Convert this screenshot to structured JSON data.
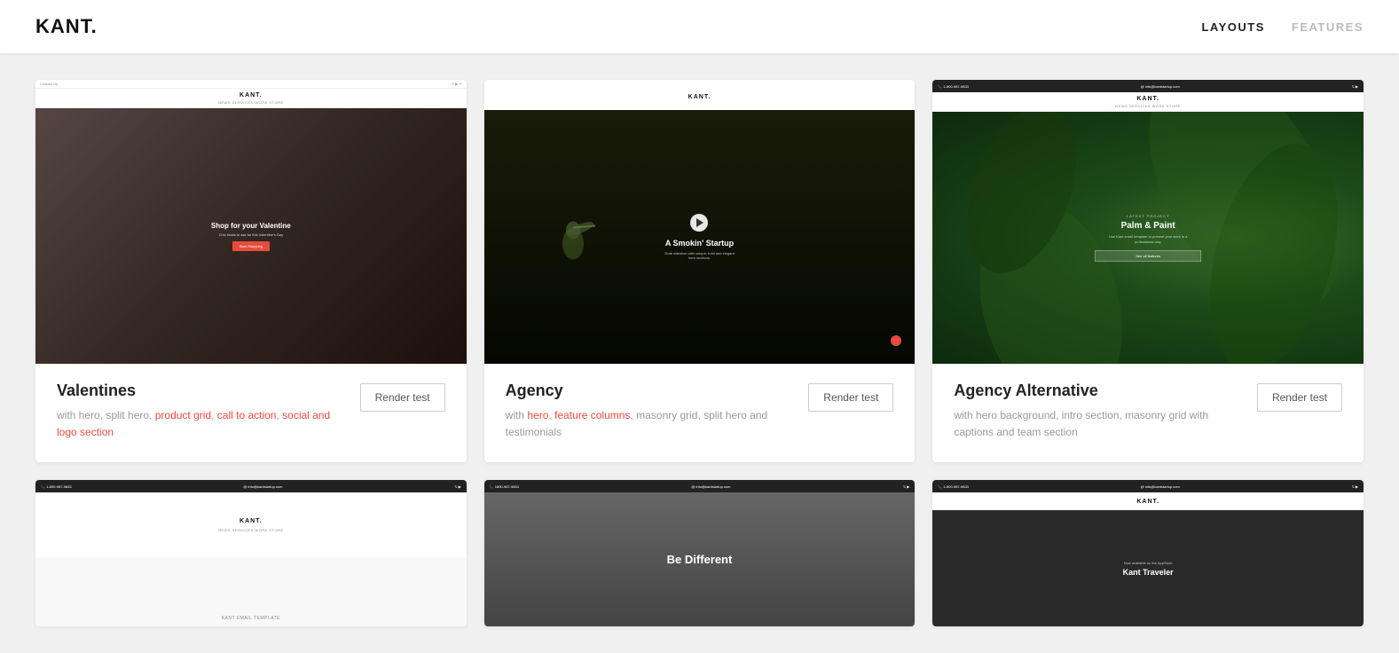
{
  "header": {
    "logo": "KANT.",
    "nav": [
      {
        "label": "LAYOUTS",
        "active": true
      },
      {
        "label": "FEATURES",
        "active": false
      }
    ]
  },
  "cards": [
    {
      "id": "valentines",
      "title": "Valentines",
      "description_parts": [
        {
          "text": "with hero, split hero, "
        },
        {
          "text": "product grid",
          "link": true
        },
        {
          "text": ", "
        },
        {
          "text": "call to action",
          "link": true
        },
        {
          "text": ", "
        },
        {
          "text": "social and logo section",
          "link": true
        }
      ],
      "render_btn": "Render test",
      "preview": {
        "topbar_text": "Contact Us",
        "topbar_icons": "✦ ▶ ✦",
        "logo": "KANT.",
        "nav_items": "NEWS    SERVICES    WORK    STORE",
        "hero_title": "Shop for your Valentine",
        "hero_subtitle": "Chic treats to ask for this Valentine's Day",
        "hero_btn": "Start Shopping"
      }
    },
    {
      "id": "agency",
      "title": "Agency",
      "description_parts": [
        {
          "text": "with "
        },
        {
          "text": "hero",
          "link": true
        },
        {
          "text": ", "
        },
        {
          "text": "feature columns",
          "link": true
        },
        {
          "text": ", masonry grid, split hero and testimonials"
        }
      ],
      "render_btn": "Render test",
      "preview": {
        "logo": "KANT.",
        "hero_title": "A Smokin' Startup",
        "hero_subtitle": "Grab attention with unique, bold and elegant hero sections."
      }
    },
    {
      "id": "agency-alternative",
      "title": "Agency Alternative",
      "description_parts": [
        {
          "text": "with hero background, intro section, masonry grid with captions and team section"
        }
      ],
      "render_btn": "Render test",
      "preview": {
        "topbar_phone": "1-800-987-9833",
        "topbar_email": "info@kantstartup.com",
        "logo": "KANT.",
        "nav_items": "NEWS    SERVICES    WORK    STORE",
        "hero_label": "LATEST PROJECT",
        "hero_title": "Palm & Paint",
        "hero_body": "Use Kant email template to present your work in a professional way.",
        "hero_btn": "See all features"
      }
    }
  ],
  "bottom_cards": [
    {
      "id": "bottom-1",
      "topbar_phone": "1-800-987-9833",
      "topbar_email": "info@kantstartup.com",
      "logo": "KANT.",
      "nav_items": "NEWS    SERVICES    WORK    STORE",
      "label": "KANT EMAIL TEMPLATE"
    },
    {
      "id": "bottom-2",
      "topbar_phone": "1800-987-9833",
      "topbar_email": "info@kantstartup.com",
      "hero_text": "Be Different"
    },
    {
      "id": "bottom-3",
      "topbar_phone": "1-800-987-9833",
      "topbar_email": "info@kantstartup.com",
      "logo": "KANT.",
      "subtitle": "Now available on the AppStore",
      "hero_text": "Kant Traveler"
    }
  ],
  "colors": {
    "accent": "#e74c3c",
    "dark": "#222",
    "muted": "#999",
    "link": "#e74c3c"
  }
}
